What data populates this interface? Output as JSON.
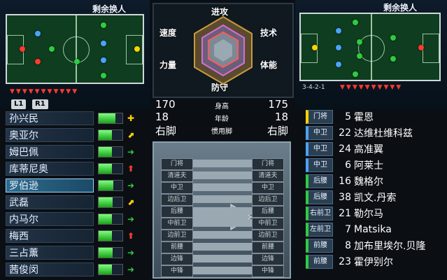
{
  "left_team": {
    "subs_label": "剩余换人",
    "buttons": {
      "l1": "L1",
      "r1": "R1"
    },
    "players": [
      {
        "name": "孙兴民",
        "stamina": 0.72,
        "cond": "plus",
        "cond_color": "#ffd400"
      },
      {
        "name": "奥亚尔",
        "stamina": 0.55,
        "cond": "ne",
        "cond_color": "#ffd400"
      },
      {
        "name": "姆巴佩",
        "stamina": 0.55,
        "cond": "right",
        "cond_color": "#2ecc40"
      },
      {
        "name": "库蒂尼奥",
        "stamina": 0.55,
        "cond": "up",
        "cond_color": "#ff3a2f"
      },
      {
        "name": "罗伯逊",
        "stamina": 0.62,
        "cond": "right",
        "cond_color": "#2ecc40"
      },
      {
        "name": "武磊",
        "stamina": 0.58,
        "cond": "ne",
        "cond_color": "#ffd400"
      },
      {
        "name": "内马尔",
        "stamina": 0.55,
        "cond": "right",
        "cond_color": "#2ecc40"
      },
      {
        "name": "梅西",
        "stamina": 0.55,
        "cond": "up",
        "cond_color": "#ff3a2f"
      },
      {
        "name": "三占薰",
        "stamina": 0.58,
        "cond": "right",
        "cond_color": "#2ecc40"
      },
      {
        "name": "茜俊闵",
        "stamina": 0.55,
        "cond": "right",
        "cond_color": "#2ecc40"
      }
    ]
  },
  "center": {
    "radar_labels": {
      "attack": "进攻",
      "technique": "技术",
      "stamina": "体能",
      "defense": "防守",
      "power": "力量",
      "speed": "速度"
    },
    "compare": [
      {
        "label": "身高",
        "left": "170",
        "right": "175"
      },
      {
        "label": "年龄",
        "left": "18",
        "right": "18"
      },
      {
        "label": "惯用脚",
        "left": "右脚",
        "right": "右脚"
      }
    ],
    "positions": [
      {
        "a": "门将",
        "b": "门将"
      },
      {
        "a": "清道夫",
        "b": "清道夫"
      },
      {
        "a": "中卫",
        "b": "中卫"
      },
      {
        "a": "边后卫",
        "b": "边后卫"
      },
      {
        "a": "后腰",
        "b": "后腰"
      },
      {
        "a": "中前卫",
        "b": "中前卫"
      },
      {
        "a": "边前卫",
        "b": "边前卫"
      },
      {
        "a": "前腰",
        "b": "前腰"
      },
      {
        "a": "边锋",
        "b": "边锋"
      },
      {
        "a": "中锋",
        "b": "中锋"
      }
    ]
  },
  "right_team": {
    "subs_label": "剩余换人",
    "formation": "3-4-2-1",
    "players": [
      {
        "pos": "门将",
        "num": "5",
        "name": "霍恩",
        "pos_color": "#ffd400"
      },
      {
        "pos": "中卫",
        "num": "22",
        "name": "达维杜维科兹",
        "pos_color": "#4aa3ff"
      },
      {
        "pos": "中卫",
        "num": "24",
        "name": "高准翼",
        "pos_color": "#4aa3ff"
      },
      {
        "pos": "中卫",
        "num": "6",
        "name": "阿莱士",
        "pos_color": "#4aa3ff"
      },
      {
        "pos": "后腰",
        "num": "16",
        "name": "魏格尔",
        "pos_color": "#2ecc40"
      },
      {
        "pos": "后腰",
        "num": "38",
        "name": "凯文.丹索",
        "pos_color": "#2ecc40"
      },
      {
        "pos": "右前卫",
        "num": "21",
        "name": "勒尔马",
        "pos_color": "#2ecc40"
      },
      {
        "pos": "左前卫",
        "num": "7",
        "name": "Matsika",
        "pos_color": "#2ecc40"
      },
      {
        "pos": "前腰",
        "num": "8",
        "name": "加布里埃尔.贝隆",
        "pos_color": "#2ecc40"
      },
      {
        "pos": "前腰",
        "num": "23",
        "name": "霍伊别尔",
        "pos_color": "#2ecc40"
      }
    ]
  }
}
